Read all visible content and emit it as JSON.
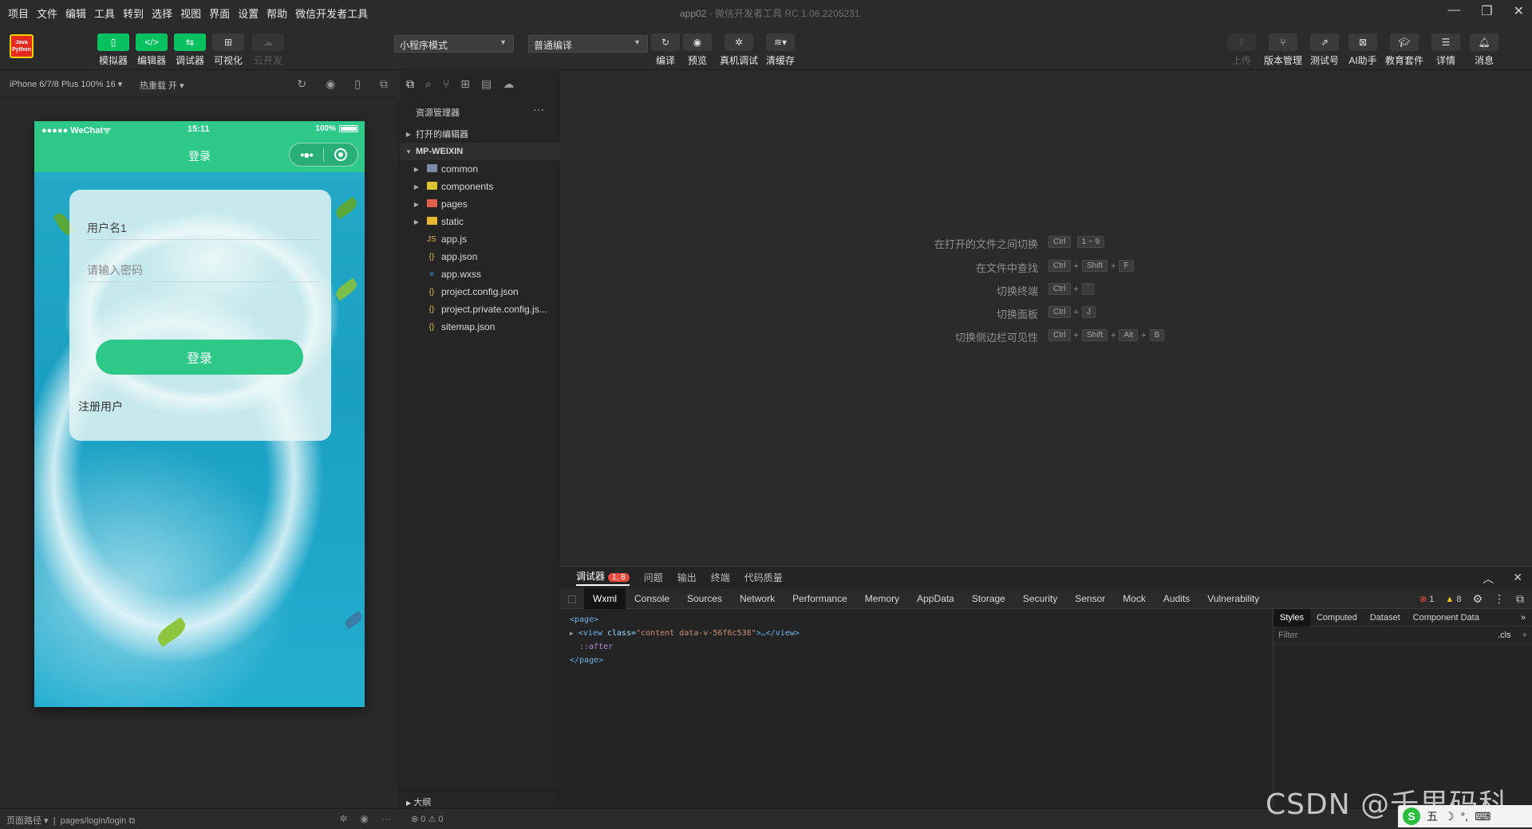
{
  "menu": [
    "项目",
    "文件",
    "编辑",
    "工具",
    "转到",
    "选择",
    "视图",
    "界面",
    "设置",
    "帮助",
    "微信开发者工具"
  ],
  "window_title": "app02",
  "window_title_suffix": " - 微信开发者工具 RC 1.06.2205231",
  "window_controls": {
    "minimize": "—",
    "restore": "❐",
    "close": "✕"
  },
  "logo": {
    "line1": "Java",
    "line2": "Python"
  },
  "toolbar": {
    "simulator": "模拟器",
    "editor": "编辑器",
    "debugger": "调试器",
    "visual": "可视化",
    "cloud": "云开发",
    "mode_select": "小程序模式",
    "compile_select": "普通编译",
    "compile": "编译",
    "preview": "预览",
    "remote_debug": "真机调试",
    "clear_cache": "清缓存",
    "upload": "上传",
    "version": "版本管理",
    "test_account": "测试号",
    "ai": "AI助手",
    "edu": "教育套件",
    "details": "详情",
    "messages": "消息"
  },
  "simbar": {
    "device": "iPhone 6/7/8 Plus 100% 16 ▾",
    "hot_reload": "热重载 开 ▾"
  },
  "phone": {
    "carrier": "●●●●● WeChat",
    "wifi": "ᯤ",
    "time": "15:11",
    "battery": "100%",
    "nav_title": "登录",
    "capsule_more": "•●•",
    "username": "用户名1",
    "password_placeholder": "请输入密码",
    "login_button": "登录",
    "register_link": "注册用户"
  },
  "bottom_left": {
    "path_label": "页面路径 ▾",
    "path": "pages/login/login"
  },
  "explorer": {
    "header": "资源管理器",
    "more": "···",
    "open_editors": "打开的编辑器",
    "project": "MP-WEIXIN",
    "items": [
      {
        "name": "common",
        "type": "folder",
        "color": "#7c8aa8"
      },
      {
        "name": "components",
        "type": "folder",
        "color": "#d9c335"
      },
      {
        "name": "pages",
        "type": "folder",
        "color": "#e0604f"
      },
      {
        "name": "static",
        "type": "folder",
        "color": "#e8b732"
      },
      {
        "name": "app.js",
        "type": "js",
        "icon": "JS"
      },
      {
        "name": "app.json",
        "type": "json",
        "icon": "{}"
      },
      {
        "name": "app.wxss",
        "type": "wxss",
        "icon": "≡"
      },
      {
        "name": "project.config.json",
        "type": "json",
        "icon": "{}"
      },
      {
        "name": "project.private.config.js...",
        "type": "json",
        "icon": "{}"
      },
      {
        "name": "sitemap.json",
        "type": "json",
        "icon": "{}"
      }
    ],
    "outline": "大纲",
    "status": "⊗ 0 ⚠ 0"
  },
  "shortcuts": [
    {
      "name": "在打开的文件之间切换",
      "keys": [
        "Ctrl",
        "1 ~ 9"
      ],
      "seps": [
        " "
      ]
    },
    {
      "name": "在文件中查找",
      "keys": [
        "Ctrl",
        "Shift",
        "F"
      ],
      "seps": [
        "+",
        "+"
      ]
    },
    {
      "name": "切换终端",
      "keys": [
        "Ctrl",
        "`"
      ],
      "seps": [
        "+"
      ]
    },
    {
      "name": "切换面板",
      "keys": [
        "Ctrl",
        "J"
      ],
      "seps": [
        "+"
      ]
    },
    {
      "name": "切换侧边栏可见性",
      "keys": [
        "Ctrl",
        "Shift",
        "Alt",
        "B"
      ],
      "seps": [
        "+",
        "+",
        "+"
      ]
    }
  ],
  "debugger": {
    "tabs": [
      "调试器",
      "问题",
      "输出",
      "终端",
      "代码质量"
    ],
    "badge": "1, 8",
    "devtools_tabs": [
      "Wxml",
      "Console",
      "Sources",
      "Network",
      "Performance",
      "Memory",
      "AppData",
      "Storage",
      "Security",
      "Sensor",
      "Mock",
      "Audits",
      "Vulnerability"
    ],
    "errors": "1",
    "warnings": "8",
    "code": {
      "line1": "<page>",
      "line2_open": "<view ",
      "line2_attr": "class=",
      "line2_val": "\"content data-v-56f6c538\"",
      "line2_close": ">…</view>",
      "line3": "::after",
      "line4": "</page>"
    },
    "style_tabs": [
      "Styles",
      "Computed",
      "Dataset",
      "Component Data"
    ],
    "filter_placeholder": "Filter",
    "cls": ".cls",
    "plus": "+"
  },
  "watermark": "CSDN @千里码科技",
  "ime": {
    "logo": "S",
    "mode": "五",
    "moon": "☽",
    "punct": "°,",
    "keyboard": "⌨"
  }
}
